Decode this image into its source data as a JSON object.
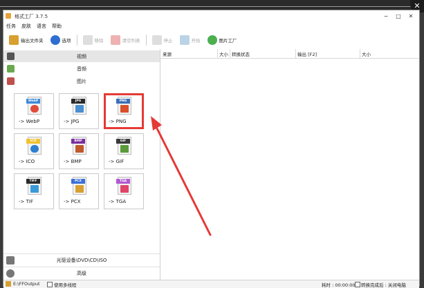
{
  "window": {
    "title": "格式工厂 3.7.5",
    "controls": [
      "−",
      "□",
      "✕"
    ]
  },
  "corner_close": "✕",
  "menu": [
    "任务",
    "皮肤",
    "语言",
    "帮助"
  ],
  "toolbar": [
    {
      "label": "输出文件夹",
      "enabled": true,
      "color": "#d8a030"
    },
    {
      "label": "选项",
      "enabled": true,
      "color": "#2f6fd1"
    },
    {
      "label": "移除",
      "enabled": false,
      "color": "#bdbdbd"
    },
    {
      "label": "清空列表",
      "enabled": false,
      "color": "#d66"
    },
    {
      "label": "停止",
      "enabled": false,
      "color": "#bdbdbd"
    },
    {
      "label": "开始",
      "enabled": false,
      "color": "#7aa8d0"
    },
    {
      "label": "图片工厂",
      "enabled": true,
      "color": "#4caf50"
    }
  ],
  "categories": {
    "video": "视频",
    "audio": "音频",
    "image": "图片",
    "rom": "光驱设备\\DVD\\CD\\ISO",
    "advanced": "高级"
  },
  "formats": [
    {
      "caption": "-> WebP",
      "tag": "WebP",
      "tagcolor": "#3c8ad8",
      "piccolor": "#e04b3a"
    },
    {
      "caption": "-> JPG",
      "tag": "JPG",
      "tagcolor": "#2a2a2a",
      "piccolor": "#4a8fd0"
    },
    {
      "caption": "-> PNG",
      "tag": "PNG",
      "tagcolor": "#3b6fb5",
      "piccolor": "#d9502a"
    },
    {
      "caption": "-> ICO",
      "tag": "ICO",
      "tagcolor": "#f2c12e",
      "piccolor": "#2f7fd1"
    },
    {
      "caption": "-> BMP",
      "tag": "BMP",
      "tagcolor": "#7a2e9e",
      "piccolor": "#c05a2a"
    },
    {
      "caption": "-> GIF",
      "tag": "GIF",
      "tagcolor": "#3a3a3a",
      "piccolor": "#5a9a3a"
    },
    {
      "caption": "-> TIF",
      "tag": "TIFF",
      "tagcolor": "#2a2a2a",
      "piccolor": "#3a9ad8"
    },
    {
      "caption": "-> PCX",
      "tag": "PCX",
      "tagcolor": "#3a6fd8",
      "piccolor": "#d8a030"
    },
    {
      "caption": "-> TGA",
      "tag": "TGA",
      "tagcolor": "#b05ad0",
      "piccolor": "#e0446a"
    }
  ],
  "columns": [
    "来源",
    "大小",
    "转换状态",
    "输出 [F2]",
    "大小"
  ],
  "status": {
    "output_path": "E:\\FFOutput",
    "multithread": "使用多线程",
    "elapsed": "耗时 : 00:00:00",
    "after_convert": "转换完成后 : 关闭电脑"
  },
  "accent": "#e53935"
}
